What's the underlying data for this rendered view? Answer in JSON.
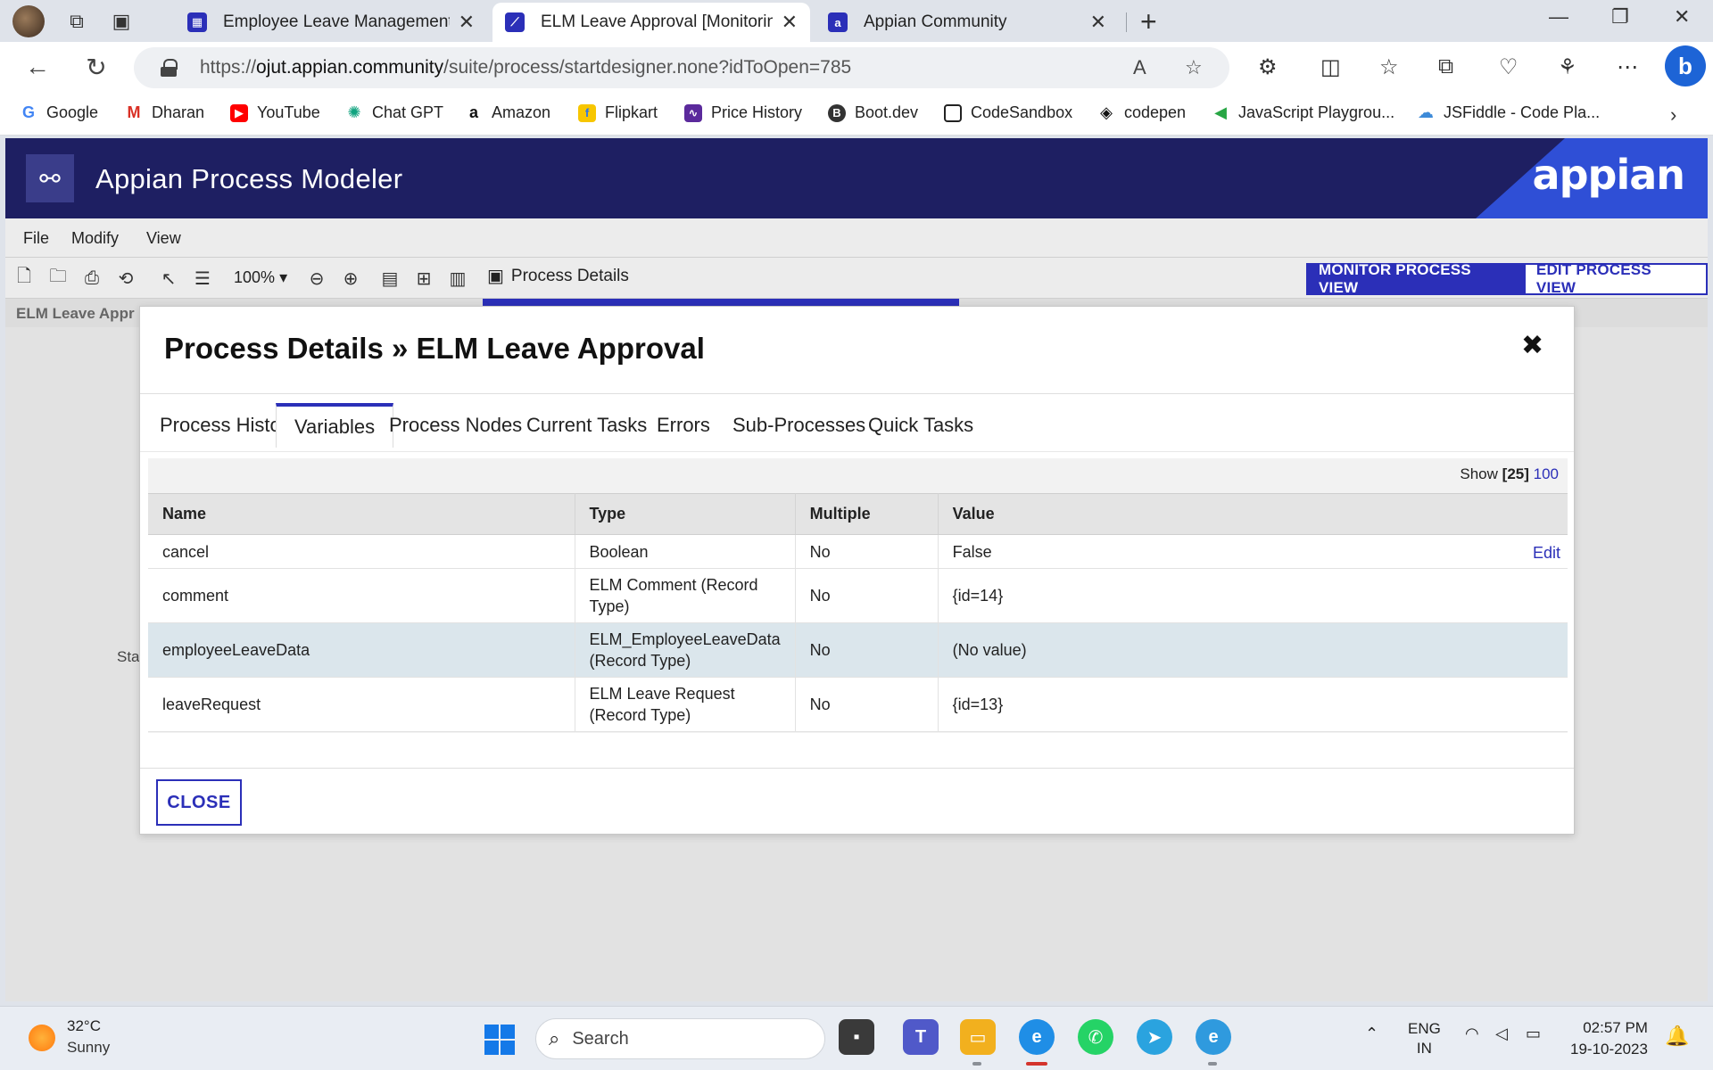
{
  "browser": {
    "tabs": [
      {
        "label": "Employee Leave Management – l",
        "active": false
      },
      {
        "label": "ELM Leave Approval [Monitoring",
        "active": true
      },
      {
        "label": "Appian Community",
        "active": false
      }
    ],
    "url_prefix": "https://",
    "url_host": "ojut.appian.community",
    "url_path": "/suite/process/startdesigner.none?idToOpen=785",
    "favorites": [
      "Google",
      "Dharan",
      "YouTube",
      "Chat GPT",
      "Amazon",
      "Flipkart",
      "Price History",
      "Boot.dev",
      "CodeSandbox",
      "codepen",
      "JavaScript Playgrou...",
      "JSFiddle - Code Pla..."
    ]
  },
  "app": {
    "title": "Appian Process Modeler",
    "brand": "appian",
    "menu": [
      "File",
      "Modify",
      "View"
    ],
    "zoom": "100%",
    "process_details_label": "Process Details",
    "monitor_view": "MONITOR PROCESS VIEW",
    "edit_view": "EDIT PROCESS VIEW",
    "process_name_truncated": "ELM Leave Appr",
    "canvas_fragment": "Sta"
  },
  "dialog": {
    "title": "Process Details » ELM Leave Approval",
    "tabs": [
      "Process History",
      "Variables",
      "Process Nodes",
      "Current Tasks",
      "Errors",
      "Sub-Processes",
      "Quick Tasks"
    ],
    "active_tab": "Variables",
    "show_label": "Show",
    "show_current": "[25]",
    "show_other": "100",
    "columns": [
      "Name",
      "Type",
      "Multiple",
      "Value"
    ],
    "rows": [
      {
        "name": "cancel",
        "type": "Boolean",
        "multiple": "No",
        "value": "False",
        "action": "Edit"
      },
      {
        "name": "comment",
        "type": "ELM Comment (Record Type)",
        "multiple": "No",
        "value": "{id=14}"
      },
      {
        "name": "employeeLeaveData",
        "type": "ELM_EmployeeLeaveData (Record Type)",
        "multiple": "No",
        "value": "(No value)"
      },
      {
        "name": "leaveRequest",
        "type": "ELM Leave Request (Record Type)",
        "multiple": "No",
        "value": "{id=13}"
      }
    ],
    "close_label": "CLOSE"
  },
  "taskbar": {
    "temp": "32°C",
    "weather": "Sunny",
    "search": "Search",
    "lang_top": "ENG",
    "lang_bottom": "IN",
    "time": "02:57 PM",
    "date": "19-10-2023"
  },
  "colors": {
    "header_navy": "#1e1f62",
    "accent": "#2b2fb8",
    "row_highlight": "#dbe6ec"
  }
}
